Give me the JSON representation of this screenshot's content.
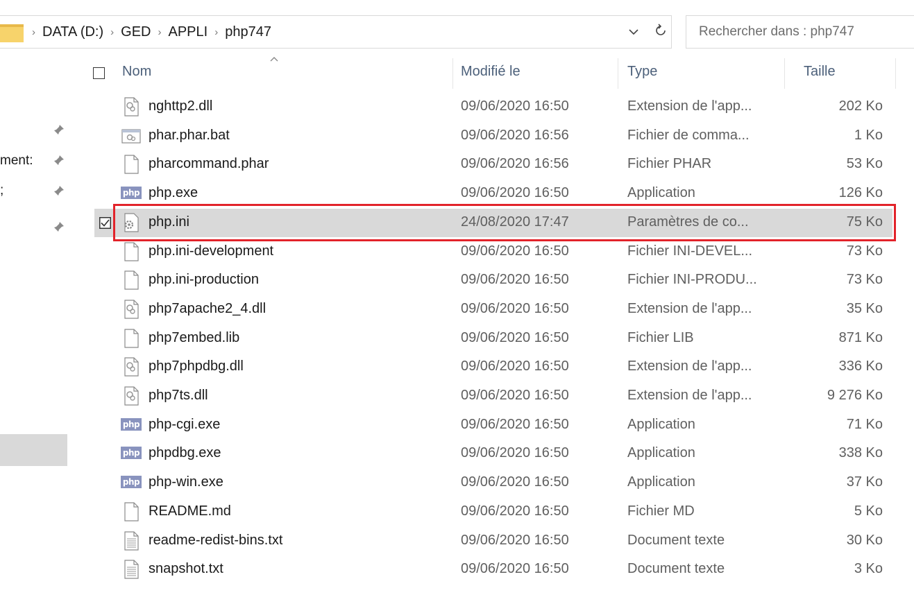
{
  "address": {
    "breadcrumbs": [
      "DATA (D:)",
      "GED",
      "APPLI",
      "php747"
    ],
    "dropdown_icon": "chevron-down-icon",
    "refresh_icon": "refresh-icon"
  },
  "search": {
    "placeholder": "Rechercher dans : php747"
  },
  "nav": {
    "items": [
      {
        "label": "ment:",
        "pinned": true
      },
      {
        "label": ";",
        "pinned": true
      }
    ]
  },
  "columns": {
    "name": "Nom",
    "modified": "Modifié le",
    "type": "Type",
    "size": "Taille"
  },
  "files": [
    {
      "name": "nghttp2.dll",
      "modified": "09/06/2020 16:50",
      "type": "Extension de l'app...",
      "size": "202 Ko",
      "icon": "dll"
    },
    {
      "name": "phar.phar.bat",
      "modified": "09/06/2020 16:56",
      "type": "Fichier de comma...",
      "size": "1 Ko",
      "icon": "bat"
    },
    {
      "name": "pharcommand.phar",
      "modified": "09/06/2020 16:56",
      "type": "Fichier PHAR",
      "size": "53 Ko",
      "icon": "blank"
    },
    {
      "name": "php.exe",
      "modified": "09/06/2020 16:50",
      "type": "Application",
      "size": "126 Ko",
      "icon": "php"
    },
    {
      "name": "php.ini",
      "modified": "24/08/2020 17:47",
      "type": "Paramètres de co...",
      "size": "75 Ko",
      "icon": "ini",
      "selected": true
    },
    {
      "name": "php.ini-development",
      "modified": "09/06/2020 16:50",
      "type": "Fichier INI-DEVEL...",
      "size": "73 Ko",
      "icon": "blank"
    },
    {
      "name": "php.ini-production",
      "modified": "09/06/2020 16:50",
      "type": "Fichier INI-PRODU...",
      "size": "73 Ko",
      "icon": "blank"
    },
    {
      "name": "php7apache2_4.dll",
      "modified": "09/06/2020 16:50",
      "type": "Extension de l'app...",
      "size": "35 Ko",
      "icon": "dll"
    },
    {
      "name": "php7embed.lib",
      "modified": "09/06/2020 16:50",
      "type": "Fichier LIB",
      "size": "871 Ko",
      "icon": "blank"
    },
    {
      "name": "php7phpdbg.dll",
      "modified": "09/06/2020 16:50",
      "type": "Extension de l'app...",
      "size": "336 Ko",
      "icon": "dll"
    },
    {
      "name": "php7ts.dll",
      "modified": "09/06/2020 16:50",
      "type": "Extension de l'app...",
      "size": "9 276 Ko",
      "icon": "dll"
    },
    {
      "name": "php-cgi.exe",
      "modified": "09/06/2020 16:50",
      "type": "Application",
      "size": "71 Ko",
      "icon": "php"
    },
    {
      "name": "phpdbg.exe",
      "modified": "09/06/2020 16:50",
      "type": "Application",
      "size": "338 Ko",
      "icon": "php"
    },
    {
      "name": "php-win.exe",
      "modified": "09/06/2020 16:50",
      "type": "Application",
      "size": "37 Ko",
      "icon": "php"
    },
    {
      "name": "README.md",
      "modified": "09/06/2020 16:50",
      "type": "Fichier MD",
      "size": "5 Ko",
      "icon": "blank"
    },
    {
      "name": "readme-redist-bins.txt",
      "modified": "09/06/2020 16:50",
      "type": "Document texte",
      "size": "30 Ko",
      "icon": "txt"
    },
    {
      "name": "snapshot.txt",
      "modified": "09/06/2020 16:50",
      "type": "Document texte",
      "size": "3 Ko",
      "icon": "txt"
    }
  ],
  "php_badge_text": "php",
  "colors": {
    "highlight": "#e2232a",
    "header_text": "#4c607a",
    "selection": "#d9d9d9",
    "php_badge": "#8993be"
  }
}
